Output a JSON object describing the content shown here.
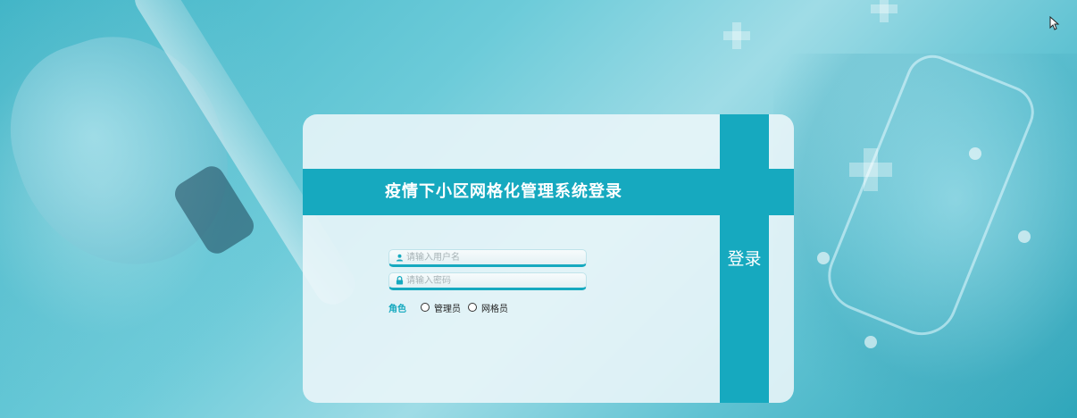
{
  "login": {
    "title": "疫情下小区网格化管理系统登录",
    "button_label": "登录",
    "username_placeholder": "请输入用户名",
    "password_placeholder": "请输入密码",
    "role_label": "角色",
    "roles": [
      "管理员",
      "网格员"
    ]
  },
  "icons": {
    "user": "user-icon",
    "lock": "lock-icon",
    "cursor": "mouse-cursor-icon"
  },
  "colors": {
    "accent": "#16a9bf",
    "card_bg": "#ecf6f9"
  }
}
